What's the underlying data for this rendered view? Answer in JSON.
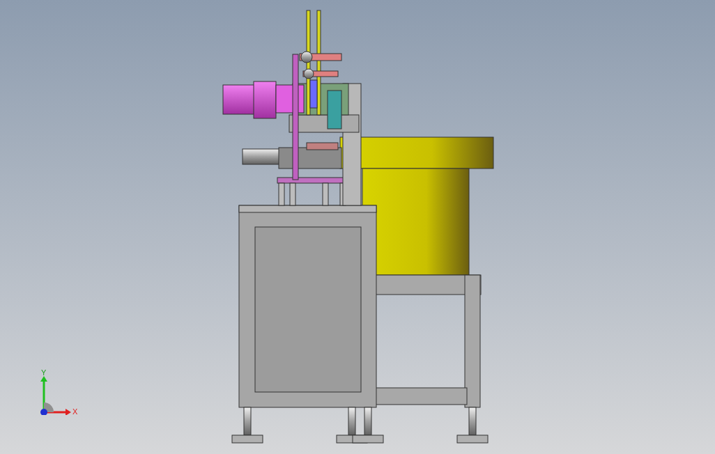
{
  "viewport": {
    "triad": {
      "y_label": "Y",
      "x_label": "X"
    }
  }
}
